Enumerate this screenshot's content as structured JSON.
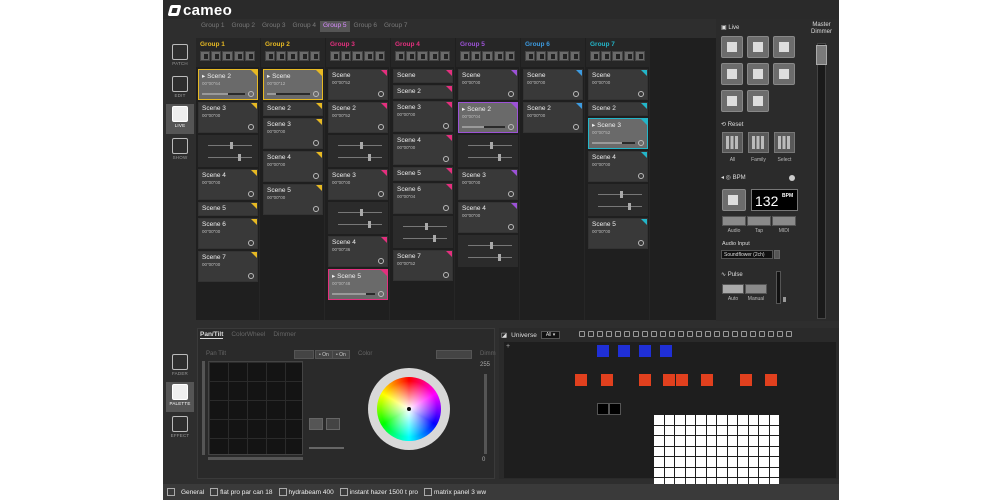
{
  "app": {
    "brand": "cameo"
  },
  "nav": {
    "top": [
      {
        "label": "PATCH"
      },
      {
        "label": "EDIT"
      },
      {
        "label": "LIVE"
      },
      {
        "label": "SHOW"
      }
    ],
    "bottom": [
      {
        "label": "FADER"
      },
      {
        "label": "PALETTE"
      },
      {
        "label": "EFFECT"
      }
    ]
  },
  "group_tabs": [
    "Group 1",
    "Group 2",
    "Group 3",
    "Group 4",
    "Group 5",
    "Group 6",
    "Group 7"
  ],
  "groups": [
    {
      "name": "Group 1",
      "color": "#e7b923",
      "scenes": [
        {
          "name": "Scene 2",
          "time": "00\"00\"64",
          "playing": true,
          "progress": 0.6,
          "size": "tall",
          "selected": true
        },
        {
          "name": "Scene 3",
          "time": "00\"00\"00",
          "size": "tall"
        },
        {
          "fx": true
        },
        {
          "name": "Scene 4",
          "time": "00\"00\"00",
          "size": "tall"
        },
        {
          "name": "Scene 5",
          "size": "short"
        },
        {
          "name": "Scene 6",
          "time": "00\"00\"00",
          "size": "tall"
        },
        {
          "name": "Scene 7",
          "time": "00\"00\"00",
          "size": "tall"
        }
      ]
    },
    {
      "name": "Group 2",
      "color": "#e7b923",
      "scenes": [
        {
          "name": "Scene",
          "time": "00\"00\"12",
          "playing": true,
          "progress": 0.2,
          "size": "tall",
          "selected": true
        },
        {
          "name": "Scene 2",
          "size": "short"
        },
        {
          "name": "Scene 3",
          "time": "00\"00\"00",
          "size": "tall"
        },
        {
          "name": "Scene 4",
          "time": "00\"00\"00",
          "size": "tall"
        },
        {
          "name": "Scene 5",
          "time": "00\"00\"00",
          "size": "tall"
        }
      ]
    },
    {
      "name": "Group 3",
      "color": "#e3307e",
      "scenes": [
        {
          "name": "Scene",
          "time": "00\"00\"52",
          "size": "tall"
        },
        {
          "name": "Scene 2",
          "time": "00\"00\"52",
          "size": "tall"
        },
        {
          "fx": true
        },
        {
          "name": "Scene 3",
          "time": "00\"00\"00",
          "size": "tall"
        },
        {
          "fx": true
        },
        {
          "name": "Scene 4",
          "time": "00\"00\"36",
          "size": "tall"
        },
        {
          "name": "Scene 5",
          "time": "00\"00\"48",
          "playing": true,
          "progress": 0.8,
          "size": "tall",
          "selected": true
        }
      ]
    },
    {
      "name": "Group 4",
      "color": "#e3307e",
      "scenes": [
        {
          "name": "Scene",
          "size": "short"
        },
        {
          "name": "Scene 2",
          "size": "short"
        },
        {
          "name": "Scene 3",
          "time": "00\"00\"00",
          "size": "tall"
        },
        {
          "name": "Scene 4",
          "time": "00\"00\"00",
          "size": "tall"
        },
        {
          "name": "Scene 5",
          "size": "short"
        },
        {
          "name": "Scene 6",
          "time": "00\"00\"04",
          "size": "tall"
        },
        {
          "fx": true
        },
        {
          "name": "Scene 7",
          "time": "00\"00\"52",
          "size": "tall"
        }
      ]
    },
    {
      "name": "Group 5",
      "color": "#9c52d6",
      "scenes": [
        {
          "name": "Scene",
          "time": "00\"00\"00",
          "size": "tall"
        },
        {
          "name": "Scene 2",
          "time": "00\"00\"04",
          "playing": true,
          "progress": 0.5,
          "size": "tall",
          "selected": true
        },
        {
          "fx": true
        },
        {
          "name": "Scene 3",
          "time": "00\"00\"00",
          "size": "tall"
        },
        {
          "name": "Scene 4",
          "time": "00\"00\"00",
          "size": "tall"
        },
        {
          "fx": true
        }
      ]
    },
    {
      "name": "Group 6",
      "color": "#3d9be0",
      "scenes": [
        {
          "name": "Scene",
          "time": "00\"00\"00",
          "size": "tall"
        },
        {
          "name": "Scene 2",
          "time": "00\"00\"00",
          "size": "tall"
        }
      ]
    },
    {
      "name": "Group 7",
      "color": "#23b6c9",
      "scenes": [
        {
          "name": "Scene",
          "time": "00\"00\"00",
          "size": "tall"
        },
        {
          "name": "Scene 2",
          "size": "short"
        },
        {
          "name": "Scene 3",
          "time": "00\"00\"52",
          "playing": true,
          "progress": 0.7,
          "size": "tall",
          "selected": true
        },
        {
          "name": "Scene 4",
          "time": "00\"00\"00",
          "size": "tall"
        },
        {
          "fx": true
        },
        {
          "name": "Scene 5",
          "time": "00\"00\"00",
          "size": "tall"
        }
      ]
    }
  ],
  "live": {
    "title": "Live",
    "reset": "Reset",
    "reset_buttons": [
      "All",
      "Family",
      "Select"
    ],
    "bpm_label": "BPM",
    "bpm_value": "132",
    "bpm_unit": "BPM",
    "bpm_sources": [
      "Audio",
      "Tap",
      "MIDI"
    ],
    "audio_input_label": "Audio Input",
    "audio_input_value": "Soundflower (2ch)",
    "pulse_label": "Pulse",
    "pulse_modes": [
      "Auto",
      "Manual"
    ]
  },
  "master": {
    "label": "Master Dimmer",
    "level": 0.95
  },
  "palette": {
    "tabs": [
      "Pan/Tilt",
      "ColorWheel",
      "Dimmer"
    ],
    "pan_tilt_label": "Pan Tilt",
    "color_label": "Color",
    "dimmer_label": "Dimm",
    "dimmer_max": "255",
    "dimmer_min": "0",
    "on_labels": [
      "On",
      "On"
    ]
  },
  "universe": {
    "title": "Universe",
    "selected": "All",
    "fixtures": [
      {
        "color": "#1f2fd6",
        "row": 0,
        "col": 0
      },
      {
        "color": "#1f2fd6",
        "row": 0,
        "col": 1
      },
      {
        "color": "#1f2fd6",
        "row": 0,
        "col": 2
      },
      {
        "color": "#1f2fd6",
        "row": 0,
        "col": 3
      },
      {
        "color": "#e1401e",
        "row": 1,
        "col": 0
      },
      {
        "color": "#e1401e",
        "row": 1,
        "col": 1
      },
      {
        "color": "#e1401e",
        "row": 1,
        "col": 2
      },
      {
        "color": "#e1401e",
        "row": 1,
        "col": 3
      },
      {
        "color": "#e1401e",
        "row": 1,
        "col": 4
      },
      {
        "color": "#e1401e",
        "row": 1,
        "col": 5
      },
      {
        "color": "#e1401e",
        "row": 1,
        "col": 6
      },
      {
        "color": "#e1401e",
        "row": 1,
        "col": 7
      },
      {
        "color": "#000000",
        "row": 2,
        "col": 0
      },
      {
        "color": "#000000",
        "row": 2,
        "col": 1
      }
    ],
    "matrix": {
      "cols": 12,
      "rows": 7,
      "color": "#ffffff"
    }
  },
  "statusbar": {
    "items": [
      "General",
      "flat pro par can 18",
      "hydrabeam 400",
      "instant hazer 1500 t pro",
      "matrix panel 3 ww"
    ]
  }
}
